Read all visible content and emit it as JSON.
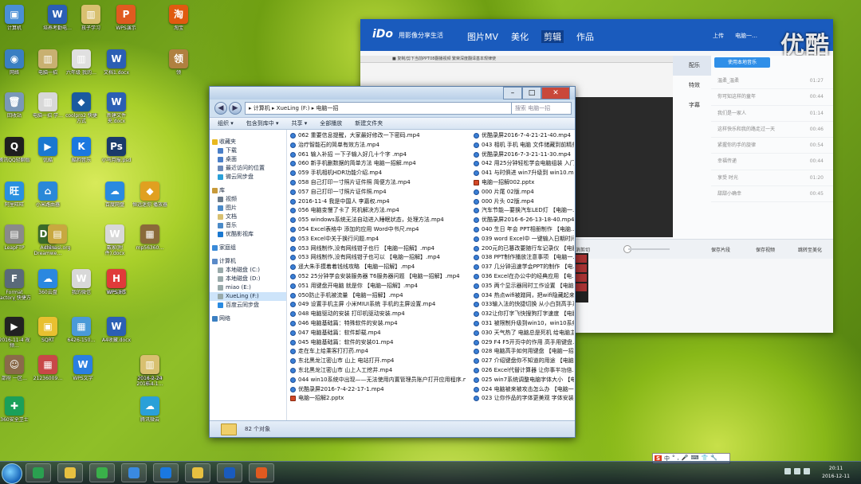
{
  "desktop": {
    "icons": [
      {
        "label": "计算机",
        "glyph": "▣",
        "color": "#4a8fd6"
      },
      {
        "label": "网络",
        "glyph": "◉",
        "color": "#3a7fc2"
      },
      {
        "label": "回收站",
        "glyph": "🗑",
        "color": "#7a98b8"
      },
      {
        "label": "腾讯QQ轻聊版",
        "glyph": "Q",
        "color": "#1f1f1f"
      },
      {
        "label": "阿里旺旺",
        "glyph": "旺",
        "color": "#2a90e0"
      },
      {
        "label": "LeapFTP",
        "glyph": "▤",
        "color": "#8a8a8a"
      },
      {
        "label": "Format Factory 快捷方式",
        "glyph": "F",
        "color": "#5a6a7a"
      },
      {
        "label": "2016-11-4 视频…",
        "glyph": "▶",
        "color": "#222222"
      },
      {
        "label": "邵府 一区…",
        "glyph": "☺",
        "color": "#8a6a4a"
      },
      {
        "label": "360安全卫士",
        "glyph": "✚",
        "color": "#1aa05a"
      },
      {
        "label": "培养考勤电…",
        "glyph": "W",
        "color": "#2b5fb4"
      },
      {
        "label": "电脑一招",
        "glyph": "▥",
        "color": "#c8b070"
      },
      {
        "label": "电脑一招 学…",
        "glyph": "▥",
        "color": "#d8d8d8"
      },
      {
        "label": "优酷",
        "glyph": "▶",
        "color": "#1a78d0"
      },
      {
        "label": "小米路由器",
        "glyph": "⌂",
        "color": "#2a88d8"
      },
      {
        "label": "Adobe Dreamwe…",
        "glyph": "Dw",
        "color": "#3a6a2a"
      },
      {
        "label": "chinasi.org",
        "glyph": "▤",
        "color": "#c8a840"
      },
      {
        "label": "360云盘",
        "glyph": "☁",
        "color": "#2a88e0"
      },
      {
        "label": "SQRT",
        "glyph": "▣",
        "color": "#e8c030"
      },
      {
        "label": "21236009…",
        "glyph": "▦",
        "color": "#c84848"
      },
      {
        "label": "WPS文字",
        "glyph": "W",
        "color": "#2a7fe0"
      },
      {
        "label": "孩子学习",
        "glyph": "▥",
        "color": "#d8c070"
      },
      {
        "label": "六年级 我的…",
        "glyph": "▥",
        "color": "#e0e0e0"
      },
      {
        "label": "coolpro2 快捷方式",
        "glyph": "◆",
        "color": "#1a5aa0"
      },
      {
        "label": "酷狗音乐",
        "glyph": "K",
        "color": "#1a78e0"
      },
      {
        "label": "百度网盘",
        "glyph": "☁",
        "color": "#2a8ae0"
      },
      {
        "label": "戴家(附件).docx",
        "glyph": "W",
        "color": "#d8d8d8"
      },
      {
        "label": "我的微信",
        "glyph": "W",
        "color": "#d8d8d8"
      },
      {
        "label": "6426-150…",
        "glyph": "▦",
        "color": "#4a9ad8"
      },
      {
        "label": "WPS演示",
        "glyph": "P",
        "color": "#e05a20"
      },
      {
        "label": "文档1.docx",
        "glyph": "W",
        "color": "#2b5fb4"
      },
      {
        "label": "新建文件 夹.docx",
        "glyph": "W",
        "color": "#2b5fb4"
      },
      {
        "label": "小马月报.psd",
        "glyph": "Ps",
        "color": "#1a3a6a"
      },
      {
        "label": "恒远迷你 播放器",
        "glyph": "◆",
        "color": "#e0a020"
      },
      {
        "label": "WPS H5",
        "glyph": "H",
        "color": "#e03a3a"
      },
      {
        "label": "A4收藏.docx",
        "glyph": "W",
        "color": "#2b5fb4"
      },
      {
        "label": "WPS演示",
        "glyph": "P",
        "color": "#e05a20"
      },
      {
        "label": "淘宝",
        "glyph": "淘",
        "color": "#e05a10"
      },
      {
        "label": "领",
        "glyph": "领",
        "color": "#b08040"
      },
      {
        "label": "mp56360…",
        "glyph": "▦",
        "color": "#8a6a3a"
      },
      {
        "label": "2014-0-10 书…",
        "glyph": "▦",
        "color": "#8a5a2a"
      },
      {
        "label": "2016-2-24 2016-4-1…",
        "glyph": "▥",
        "color": "#d8c070"
      },
      {
        "label": "腾讯微云",
        "glyph": "☁",
        "color": "#2aa0d8"
      }
    ]
  },
  "explorer": {
    "path": "▸ 计算机 ▸ XueLing (F:) ▸ 电脑一招",
    "search_placeholder": "搜索 电脑一招",
    "toolbar": [
      "组织 ▾",
      "包含到库中 ▾",
      "共享 ▾",
      "全部播放",
      "新建文件夹"
    ],
    "nav": [
      {
        "label": "收藏夹",
        "type": "header",
        "color": "#e8b820"
      },
      {
        "label": "下载",
        "type": "item",
        "color": "#4a7fc8"
      },
      {
        "label": "桌面",
        "type": "item",
        "color": "#4a7fc8"
      },
      {
        "label": "最近访问的位置",
        "type": "item",
        "color": "#6a8ab8"
      },
      {
        "label": "微云同步盘",
        "type": "item",
        "color": "#2aa0d8"
      },
      {
        "label": "库",
        "type": "header",
        "color": "#c89a3a"
      },
      {
        "label": "视频",
        "type": "item",
        "color": "#6a7a8a"
      },
      {
        "label": "图片",
        "type": "item",
        "color": "#4a8ac8"
      },
      {
        "label": "文档",
        "type": "item",
        "color": "#d8c070"
      },
      {
        "label": "音乐",
        "type": "item",
        "color": "#4a8ac8"
      },
      {
        "label": "优酷影视库",
        "type": "item",
        "color": "#1a78d0"
      },
      {
        "label": "家庭组",
        "type": "header",
        "color": "#3a8ad8"
      },
      {
        "label": "计算机",
        "type": "header",
        "color": "#5a8ac8"
      },
      {
        "label": "本地磁盘 (C:)",
        "type": "item",
        "color": "#9aa"
      },
      {
        "label": "本地磁盘 (D:)",
        "type": "item",
        "color": "#9aa"
      },
      {
        "label": "miao (E:)",
        "type": "item",
        "color": "#9aa"
      },
      {
        "label": "XueLing (F:)",
        "type": "item",
        "color": "#9aa",
        "selected": true
      },
      {
        "label": "百度云同步盘",
        "type": "item",
        "color": "#2a8ae0"
      },
      {
        "label": "网络",
        "type": "header",
        "color": "#3a7fc2"
      }
    ],
    "files_col1": [
      "062 重要信息提醒，大家最好修改一下密码.mp4",
      "治疗智能石的简单有效方法.mp4",
      "061 输入补招 一下子输入好几十个字 .mp4",
      "060 新手机删数据的简单方法 电脑一招解.mp4",
      "059 手机相机HDR功能介绍.mp4",
      "058 自己打印一寸照片证件照 简便方法.mp4",
      "057 自己打印一寸照片证件照.mp4",
      "2016-11-4 我是中国人 李嘉权.mp4",
      "056 电脑变慢了卡了 死机解决方法.mp4",
      "055 windows系统无法自动进入睡眠状态，处理方法.mp4",
      "054 Excel表格中 添加的应用 Word中书尺.mp4",
      "053 Excel中关于换行问题.mp4",
      "053 网线制作,没有网线钳子也行 【电脑一招解】.mp4",
      "053 网线制作,没有网线钳子也可以 【电脑一招解】.mp4",
      "遥大朱手摸着着钱线攻略 【电脑一招解】.mp4",
      "052 25分钟学会安装服务器 T6服务器问题 【电脑一招解】.mp4",
      "051 用键盘开电脑 就是你 【电脑一招解】.mp4",
      "050防止手机被流量 【电脑一招解】.mp4",
      "049 设置手机主屏 小米MIUI系统 手机的主屏设置.mp4",
      "048 电脑驱动的安装 打印机驱动安装.mp4",
      "046 电脑基础篇：特殊软件的安装.mp4",
      "047 电脑基础篇：软件卸载.mp4",
      "045 电脑基础篇：软件的安装01.mp4",
      "走在车上给乘客打打药.mp4",
      "东北黑龙江密山市 山上 电站打开.mp4",
      "东北黑龙江密山市 山上人工挖井.mp4",
      "044 win10系统中出现——无法使用内置管理员账户打开应用程序.mp4",
      "优酷录屏2016-7-4-22-17-1.mp4",
      "电脑一招解2.pptx"
    ],
    "files_col2": [
      "优酷录屏2016-7-4-21-21-40.mp4",
      "043 相机 手机 电脑 文件储藏到前精美 电…",
      "优酷录屏2016-7-3-21-11-30.mp4",
      "042 用25分钟轻松学会电脑组装 入门…",
      "041 与时俱进 win7升级到 win10.mp4",
      "电脑一招解002.pptx",
      "000 片尾 02版.mp4",
      "000 片头 02版.mp4",
      "汽车节能—要换汽车LED灯 【电脑一…",
      "优酷录屏2016-6-26-13-18-40.mp4",
      "040 生日 年会 PPT相册制作 【电脑…",
      "039 word Excel中 一键输入日期时间…",
      "200元的已篡改要随行车记录仪 【电脑…",
      "038 PPT制作播放注意事项 【电脑一…",
      "037 几分钟迅速学会PPT的制作 【电…",
      "036 Excel在办公中的经典应用 【电…",
      "035 两个显示器同时工作设置 【电脑…",
      "034 热点wifi被蹭网，把wifi隐藏起来 【电…",
      "033输入法的快捷切换 从小白到高手系…",
      "032让你打字飞快搜狗打字速度 【电脑…",
      "031 被限制升级到win10，win10系统…",
      "030 天气热了 电脑总是死机 给电脑主…",
      "029 F4 F5开页中的作用 高手用键盘…",
      "028 电脑高手如何用键盘 【电脑一招解…",
      "027 介绍键盘你不知道的用途 【电脑…",
      "026 Excel代替计算器 让你事半功倍…",
      "025 win7系统调整电脑字体大小 【电…",
      "024 电脑被来被攻击怎么办 【电脑一招…",
      "023 让你作品的字体更美观 字体安装…"
    ],
    "status_count": "82 个对象"
  },
  "player": {
    "logo": "iDo",
    "tagline": "用影像分享生活",
    "tabs": [
      "图片MV",
      "美化",
      "剪辑",
      "作品"
    ],
    "active_tab": "剪辑",
    "user": [
      "上传",
      "电脑一…"
    ],
    "watermark": "优酷",
    "side_nav": [
      "配乐",
      "特效",
      "字幕"
    ],
    "upload_music": "使用本地音乐",
    "songs": [
      {
        "title": "温柔_温柔",
        "time": "01:27"
      },
      {
        "title": "你可知这样的童年",
        "time": "00:44"
      },
      {
        "title": "我们是一家人",
        "time": "01:14"
      },
      {
        "title": "这样快乐和我的路走过一天",
        "time": "00:46"
      },
      {
        "title": "紧握你的手的旋律",
        "time": "00:54"
      },
      {
        "title": "幸福传递",
        "time": "00:44"
      },
      {
        "title": "享受 时光",
        "time": "01:20"
      },
      {
        "title": "甜甜小确幸",
        "time": "00:45"
      }
    ],
    "controls": [
      "消剪切",
      "保存片段",
      "保存视频",
      "跳转至美化"
    ],
    "video_header": "■ 复制/剪下当前PPT08翻播视频 繁荣深度翻译基本规律使"
  },
  "taskbar": {
    "time": "20:11",
    "date": "2016-12-11",
    "ime": [
      "中",
      "°",
      ",",
      "🎤",
      "⌨",
      "👕",
      "🔧"
    ],
    "ime_logo": "S",
    "apps": [
      {
        "name": "360",
        "color": "#2aa050"
      },
      {
        "name": "folder",
        "color": "#e8c040"
      },
      {
        "name": "wechat",
        "color": "#3ab04a"
      },
      {
        "name": "wifi",
        "color": "#3a8ae0"
      },
      {
        "name": "youku",
        "color": "#1a78e0"
      },
      {
        "name": "explorer",
        "color": "#e8c040"
      },
      {
        "name": "ido",
        "color": "#1a5bbd"
      },
      {
        "name": "wps-p",
        "color": "#e05a20"
      }
    ]
  }
}
